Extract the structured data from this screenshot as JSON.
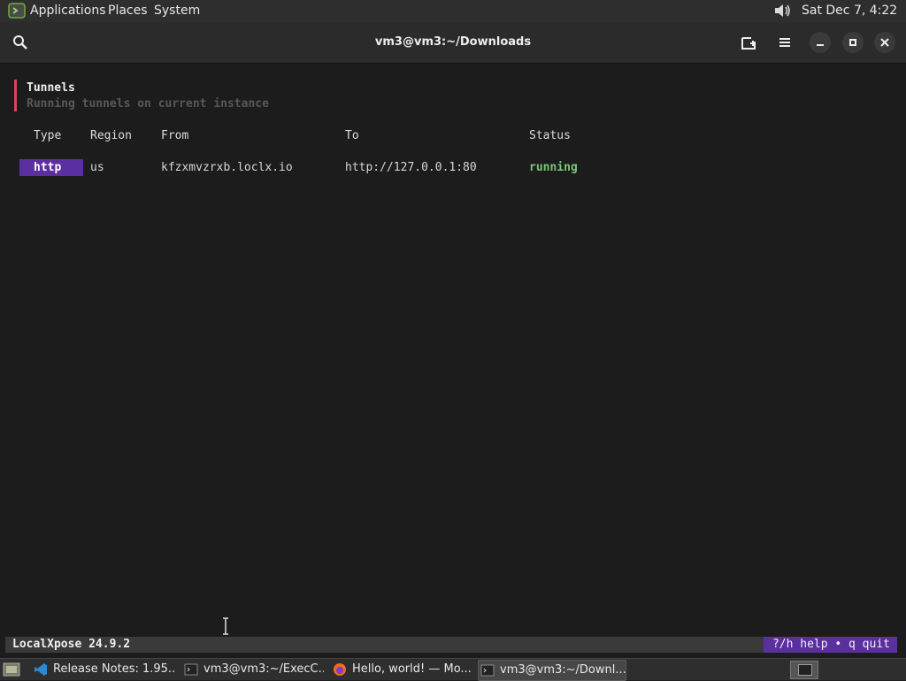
{
  "top_panel": {
    "menus": [
      "Applications",
      "Places",
      "System"
    ],
    "clock": "Sat Dec 7, 4:22 AM",
    "icons": {
      "apps": "terminal-logo-icon",
      "volume": "volume-icon"
    }
  },
  "window": {
    "title": "vm3@vm3:~/Downloads",
    "icons": [
      "search-icon",
      "new-tab-icon",
      "hamburger-menu-icon",
      "minimize-icon",
      "maximize-icon",
      "close-icon"
    ]
  },
  "tunnels": {
    "title": "Tunnels",
    "subtitle": "Running tunnels on current instance",
    "columns": [
      "Type",
      "Region",
      "From",
      "To",
      "Status"
    ],
    "rows": [
      {
        "type": "http",
        "region": "us",
        "from": "kfzxmvzrxb.loclx.io",
        "to": "http://127.0.0.1:80",
        "status": "running"
      }
    ]
  },
  "status_bar": {
    "app": "LocalXpose 24.9.2",
    "help": "?/h help • q quit"
  },
  "colors": {
    "accent_purple": "#5b2fa0",
    "accent_red": "#d9455f",
    "status_green": "#7bc67b",
    "terminal_bg": "#1c1c1c"
  },
  "taskbar": {
    "items": [
      {
        "label": "Release Notes: 1.95....",
        "icon": "vscode-icon"
      },
      {
        "label": "vm3@vm3:~/ExecC...",
        "icon": "terminal-icon"
      },
      {
        "label": "Hello, world! — Mo...",
        "icon": "firefox-icon"
      },
      {
        "label": "vm3@vm3:~/Downl...",
        "icon": "terminal-icon",
        "active": true
      }
    ]
  }
}
